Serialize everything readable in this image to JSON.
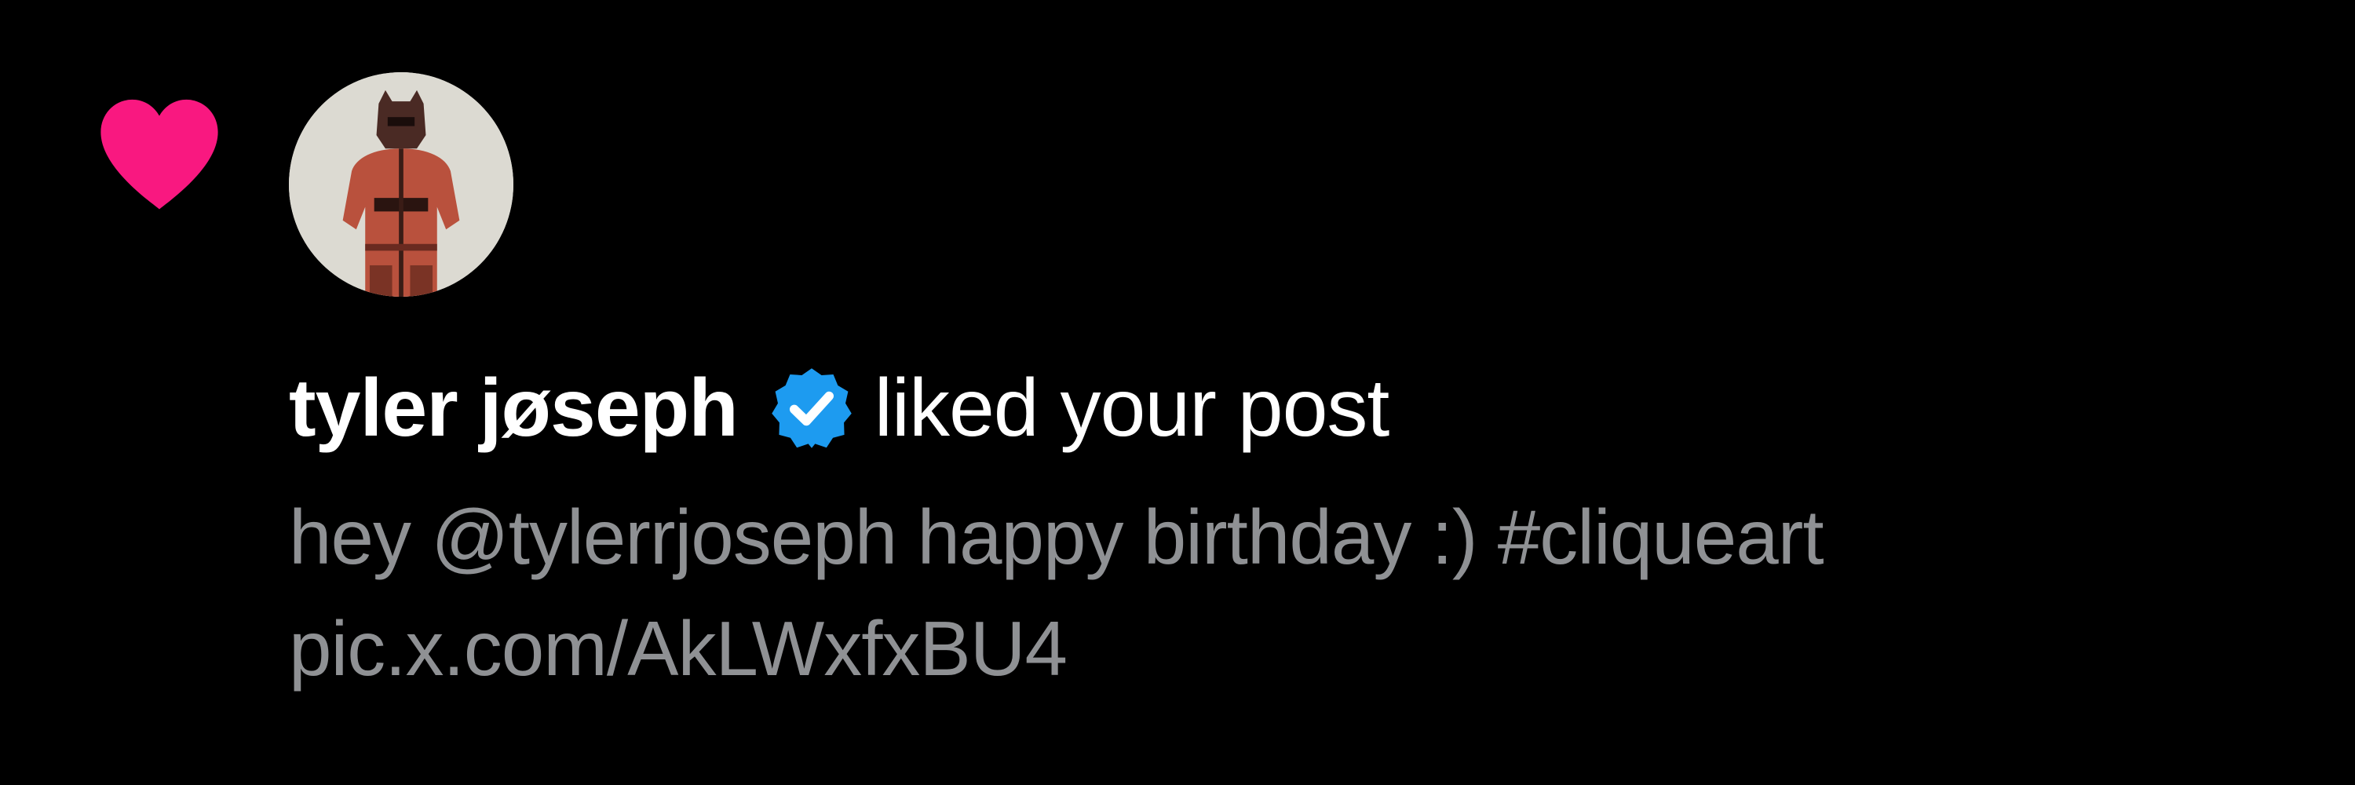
{
  "notification": {
    "type_icon": "heart-icon",
    "user": {
      "display_name": "tyler jøseph",
      "verified": true,
      "badge_icon": "verified-badge-icon"
    },
    "action": "liked your post",
    "post": {
      "line1": "hey @tylerrjoseph happy birthday :) #cliqueart",
      "line2": "pic.x.com/AkLWxfxBU4"
    }
  },
  "colors": {
    "background": "#000000",
    "heart": "#f91880",
    "verified": "#1d9bf0",
    "primary_text": "#ffffff",
    "secondary_text": "#8f9194"
  }
}
